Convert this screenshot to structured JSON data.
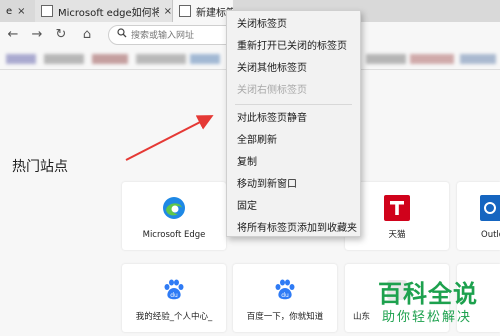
{
  "tabs": [
    {
      "title": "e",
      "close": "×"
    },
    {
      "title": "Microsoft edge如何将其中",
      "close": "×"
    },
    {
      "title": "新建标签页",
      "close": ""
    }
  ],
  "nav": {
    "back": "←",
    "forward": "→",
    "refresh": "↻",
    "home": "⌂",
    "search_placeholder": "搜索或输入网址"
  },
  "page": {
    "hot_sites_title": "热门站点",
    "tiles": [
      {
        "label": "Microsoft Edge",
        "icon": "edge-icon"
      },
      {
        "label": "天猫",
        "icon": "tmall-icon"
      },
      {
        "label": "Outlo",
        "icon": "outlook-icon"
      },
      {
        "label": "我的经验_个人中心_",
        "icon": "baidu-icon"
      },
      {
        "label": "百度一下，你就知道",
        "icon": "baidu-icon"
      },
      {
        "label": "山东",
        "icon": "generic-icon"
      }
    ]
  },
  "context_menu": {
    "items": [
      {
        "label": "关闭标签页",
        "enabled": true
      },
      {
        "label": "重新打开已关闭的标签页",
        "enabled": true
      },
      {
        "label": "关闭其他标签页",
        "enabled": true
      },
      {
        "label": "关闭右侧标签页",
        "enabled": false
      },
      {
        "label": "对此标签页静音",
        "enabled": true
      },
      {
        "label": "全部刷新",
        "enabled": true
      },
      {
        "label": "复制",
        "enabled": true
      },
      {
        "label": "移动到新窗口",
        "enabled": true
      },
      {
        "label": "固定",
        "enabled": true
      },
      {
        "label": "将所有标签页添加到收藏夹",
        "enabled": true
      }
    ]
  },
  "watermark": {
    "title": "百科全说",
    "subtitle": "助你轻松解决"
  },
  "colors": {
    "arrow": "#e53935",
    "watermark": "#1da14e",
    "edge_blue": "#1e88e5",
    "tmall_red": "#d0021b",
    "baidu_blue": "#2f7bf5"
  }
}
